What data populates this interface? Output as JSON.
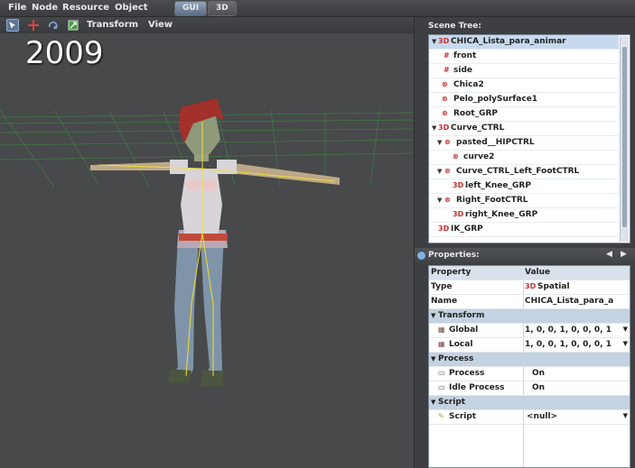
{
  "menubar": {
    "items": [
      "File",
      "Node",
      "Resource",
      "Object"
    ],
    "mode_tabs": [
      "GUI",
      "3D"
    ]
  },
  "toolbar": {
    "transform_label": "Transform",
    "view_label": "View"
  },
  "viewport": {
    "year_overlay": "2009"
  },
  "scene_tree": {
    "title": "Scene Tree:",
    "rows": [
      {
        "label": "CHICA_Lista_para_animar",
        "icon": "3D"
      },
      {
        "label": "front",
        "icon": "camera"
      },
      {
        "label": "side",
        "icon": "camera"
      },
      {
        "label": "Chica2",
        "icon": "mesh"
      },
      {
        "label": "Pelo_polySurface1",
        "icon": "mesh"
      },
      {
        "label": "Root_GRP",
        "icon": "mesh"
      },
      {
        "label": "Curve_CTRL",
        "icon": "3D"
      },
      {
        "label": "pasted__HIPCTRL",
        "icon": "mesh"
      },
      {
        "label": "curve2",
        "icon": "mesh"
      },
      {
        "label": "Curve_CTRL_Left_FootCTRL",
        "icon": "mesh"
      },
      {
        "label": "left_Knee_GRP",
        "icon": "3D"
      },
      {
        "label": "Right_FootCTRL",
        "icon": "mesh"
      },
      {
        "label": "right_Knee_GRP",
        "icon": "3D"
      },
      {
        "label": "IK_GRP",
        "icon": "3D"
      }
    ]
  },
  "properties": {
    "title": "Properties:",
    "col_property": "Property",
    "col_value": "Value",
    "type_label": "Type",
    "type_icon": "3D",
    "type_value": "Spatial",
    "name_label": "Name",
    "name_value": "CHICA_Lista_para_a",
    "transform_section": "Transform",
    "global_label": "Global",
    "global_value": "1, 0, 0, 1, 0, 0, 0, 1",
    "local_label": "Local",
    "local_value": "1, 0, 0, 1, 0, 0, 0, 1",
    "process_section": "Process",
    "process_label": "Process",
    "process_value": "On",
    "idle_label": "Idle Process",
    "idle_value": "On",
    "script_section": "Script",
    "script_label": "Script",
    "script_value": "<null>"
  },
  "colors": {
    "accent": "#5d7593",
    "selected_row": "#c7d9ee",
    "section_row": "#c4d2e1",
    "icon_red": "#c23030"
  }
}
